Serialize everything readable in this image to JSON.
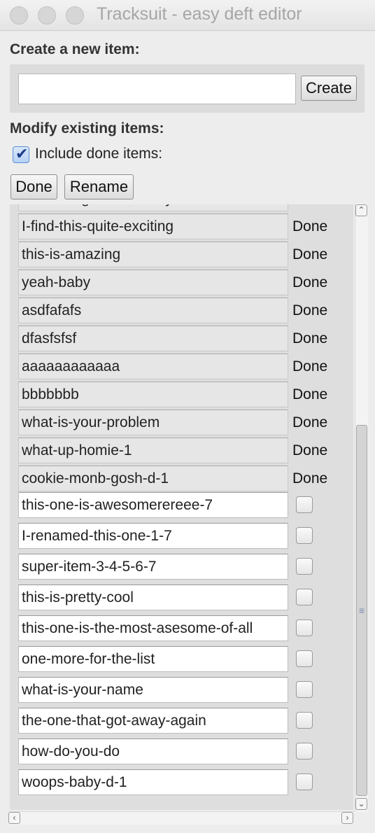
{
  "window": {
    "title": "Tracksuit - easy deft editor"
  },
  "create": {
    "heading": "Create a new item:",
    "input_value": "",
    "button_label": "Create"
  },
  "modify": {
    "heading": "Modify existing items:",
    "include_done_label": "Include done items:",
    "include_done_checked": true,
    "done_button": "Done",
    "rename_button": "Rename"
  },
  "done_items": [
    {
      "name": "something-more-to-say",
      "status": "Done"
    },
    {
      "name": "I-find-this-quite-exciting",
      "status": "Done"
    },
    {
      "name": "this-is-amazing",
      "status": "Done"
    },
    {
      "name": "yeah-baby",
      "status": "Done"
    },
    {
      "name": "asdfafafs",
      "status": "Done"
    },
    {
      "name": "dfasfsfsf",
      "status": "Done"
    },
    {
      "name": "aaaaaaaaaaaa",
      "status": "Done"
    },
    {
      "name": "bbbbbbb",
      "status": "Done"
    },
    {
      "name": "what-is-your-problem",
      "status": "Done"
    },
    {
      "name": "what-up-homie-1",
      "status": "Done"
    },
    {
      "name": "cookie-monb-gosh-d-1",
      "status": "Done"
    }
  ],
  "open_items": [
    {
      "name": "this-one-is-awesomerereee-7",
      "checked": false
    },
    {
      "name": "I-renamed-this-one-1-7",
      "checked": false
    },
    {
      "name": "super-item-3-4-5-6-7",
      "checked": false
    },
    {
      "name": "this-is-pretty-cool",
      "checked": false
    },
    {
      "name": "this-one-is-the-most-asesome-of-all",
      "checked": false
    },
    {
      "name": "one-more-for-the-list",
      "checked": false
    },
    {
      "name": "what-is-your-name",
      "checked": false
    },
    {
      "name": "the-one-that-got-away-again",
      "checked": false
    },
    {
      "name": "how-do-you-do",
      "checked": false
    },
    {
      "name": "woops-baby-d-1",
      "checked": false
    }
  ],
  "icons": {
    "close": "close-icon",
    "minimize": "minimize-icon",
    "zoom": "zoom-icon",
    "checkmark": "checkmark-icon",
    "scroll_up": "chevron-up-icon",
    "scroll_down": "chevron-down-icon",
    "scroll_left": "chevron-left-icon",
    "scroll_right": "chevron-right-icon",
    "grip": "grip-icon"
  }
}
